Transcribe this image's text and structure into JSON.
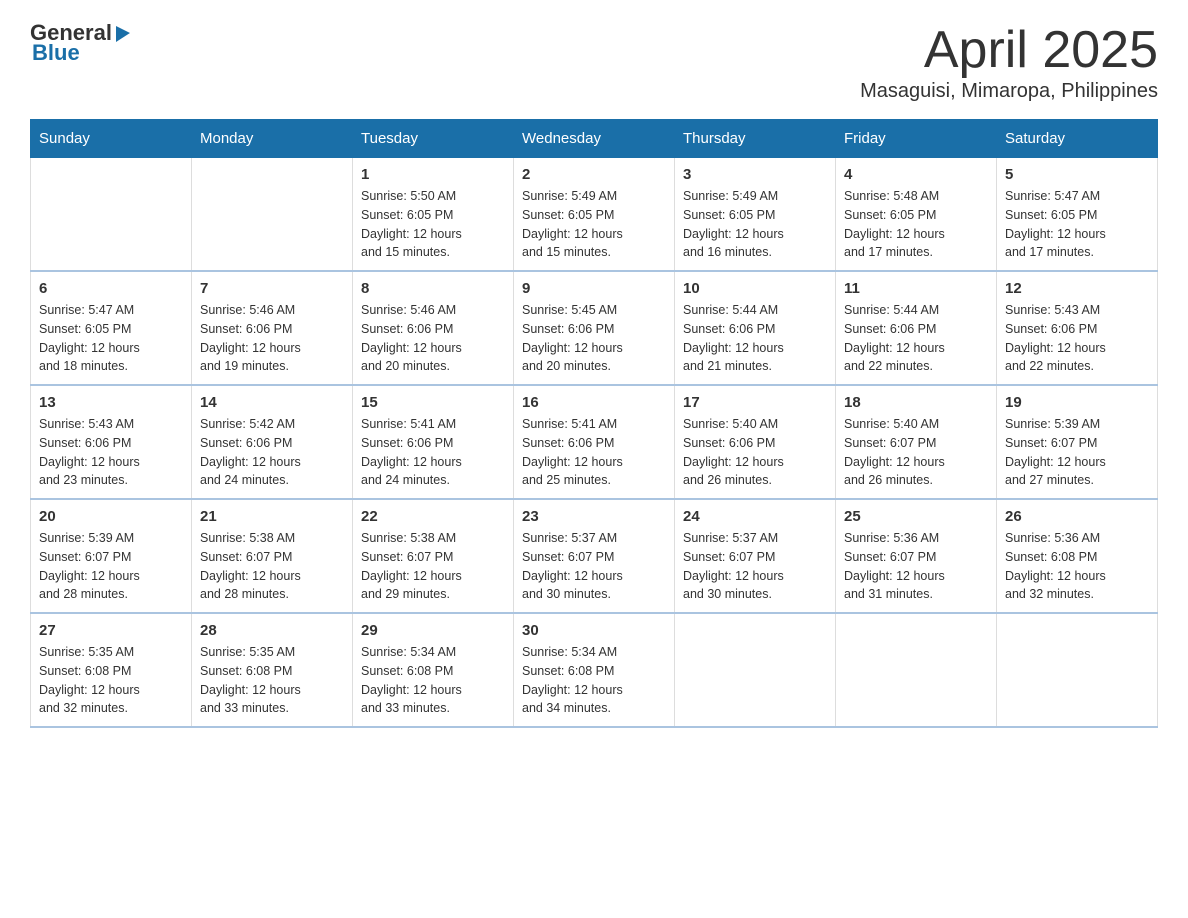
{
  "header": {
    "logo": {
      "general": "General",
      "blue": "Blue"
    },
    "title": "April 2025",
    "location": "Masaguisi, Mimaropa, Philippines"
  },
  "calendar": {
    "days_of_week": [
      "Sunday",
      "Monday",
      "Tuesday",
      "Wednesday",
      "Thursday",
      "Friday",
      "Saturday"
    ],
    "weeks": [
      [
        {
          "day": "",
          "info": ""
        },
        {
          "day": "",
          "info": ""
        },
        {
          "day": "1",
          "info": "Sunrise: 5:50 AM\nSunset: 6:05 PM\nDaylight: 12 hours\nand 15 minutes."
        },
        {
          "day": "2",
          "info": "Sunrise: 5:49 AM\nSunset: 6:05 PM\nDaylight: 12 hours\nand 15 minutes."
        },
        {
          "day": "3",
          "info": "Sunrise: 5:49 AM\nSunset: 6:05 PM\nDaylight: 12 hours\nand 16 minutes."
        },
        {
          "day": "4",
          "info": "Sunrise: 5:48 AM\nSunset: 6:05 PM\nDaylight: 12 hours\nand 17 minutes."
        },
        {
          "day": "5",
          "info": "Sunrise: 5:47 AM\nSunset: 6:05 PM\nDaylight: 12 hours\nand 17 minutes."
        }
      ],
      [
        {
          "day": "6",
          "info": "Sunrise: 5:47 AM\nSunset: 6:05 PM\nDaylight: 12 hours\nand 18 minutes."
        },
        {
          "day": "7",
          "info": "Sunrise: 5:46 AM\nSunset: 6:06 PM\nDaylight: 12 hours\nand 19 minutes."
        },
        {
          "day": "8",
          "info": "Sunrise: 5:46 AM\nSunset: 6:06 PM\nDaylight: 12 hours\nand 20 minutes."
        },
        {
          "day": "9",
          "info": "Sunrise: 5:45 AM\nSunset: 6:06 PM\nDaylight: 12 hours\nand 20 minutes."
        },
        {
          "day": "10",
          "info": "Sunrise: 5:44 AM\nSunset: 6:06 PM\nDaylight: 12 hours\nand 21 minutes."
        },
        {
          "day": "11",
          "info": "Sunrise: 5:44 AM\nSunset: 6:06 PM\nDaylight: 12 hours\nand 22 minutes."
        },
        {
          "day": "12",
          "info": "Sunrise: 5:43 AM\nSunset: 6:06 PM\nDaylight: 12 hours\nand 22 minutes."
        }
      ],
      [
        {
          "day": "13",
          "info": "Sunrise: 5:43 AM\nSunset: 6:06 PM\nDaylight: 12 hours\nand 23 minutes."
        },
        {
          "day": "14",
          "info": "Sunrise: 5:42 AM\nSunset: 6:06 PM\nDaylight: 12 hours\nand 24 minutes."
        },
        {
          "day": "15",
          "info": "Sunrise: 5:41 AM\nSunset: 6:06 PM\nDaylight: 12 hours\nand 24 minutes."
        },
        {
          "day": "16",
          "info": "Sunrise: 5:41 AM\nSunset: 6:06 PM\nDaylight: 12 hours\nand 25 minutes."
        },
        {
          "day": "17",
          "info": "Sunrise: 5:40 AM\nSunset: 6:06 PM\nDaylight: 12 hours\nand 26 minutes."
        },
        {
          "day": "18",
          "info": "Sunrise: 5:40 AM\nSunset: 6:07 PM\nDaylight: 12 hours\nand 26 minutes."
        },
        {
          "day": "19",
          "info": "Sunrise: 5:39 AM\nSunset: 6:07 PM\nDaylight: 12 hours\nand 27 minutes."
        }
      ],
      [
        {
          "day": "20",
          "info": "Sunrise: 5:39 AM\nSunset: 6:07 PM\nDaylight: 12 hours\nand 28 minutes."
        },
        {
          "day": "21",
          "info": "Sunrise: 5:38 AM\nSunset: 6:07 PM\nDaylight: 12 hours\nand 28 minutes."
        },
        {
          "day": "22",
          "info": "Sunrise: 5:38 AM\nSunset: 6:07 PM\nDaylight: 12 hours\nand 29 minutes."
        },
        {
          "day": "23",
          "info": "Sunrise: 5:37 AM\nSunset: 6:07 PM\nDaylight: 12 hours\nand 30 minutes."
        },
        {
          "day": "24",
          "info": "Sunrise: 5:37 AM\nSunset: 6:07 PM\nDaylight: 12 hours\nand 30 minutes."
        },
        {
          "day": "25",
          "info": "Sunrise: 5:36 AM\nSunset: 6:07 PM\nDaylight: 12 hours\nand 31 minutes."
        },
        {
          "day": "26",
          "info": "Sunrise: 5:36 AM\nSunset: 6:08 PM\nDaylight: 12 hours\nand 32 minutes."
        }
      ],
      [
        {
          "day": "27",
          "info": "Sunrise: 5:35 AM\nSunset: 6:08 PM\nDaylight: 12 hours\nand 32 minutes."
        },
        {
          "day": "28",
          "info": "Sunrise: 5:35 AM\nSunset: 6:08 PM\nDaylight: 12 hours\nand 33 minutes."
        },
        {
          "day": "29",
          "info": "Sunrise: 5:34 AM\nSunset: 6:08 PM\nDaylight: 12 hours\nand 33 minutes."
        },
        {
          "day": "30",
          "info": "Sunrise: 5:34 AM\nSunset: 6:08 PM\nDaylight: 12 hours\nand 34 minutes."
        },
        {
          "day": "",
          "info": ""
        },
        {
          "day": "",
          "info": ""
        },
        {
          "day": "",
          "info": ""
        }
      ]
    ]
  }
}
